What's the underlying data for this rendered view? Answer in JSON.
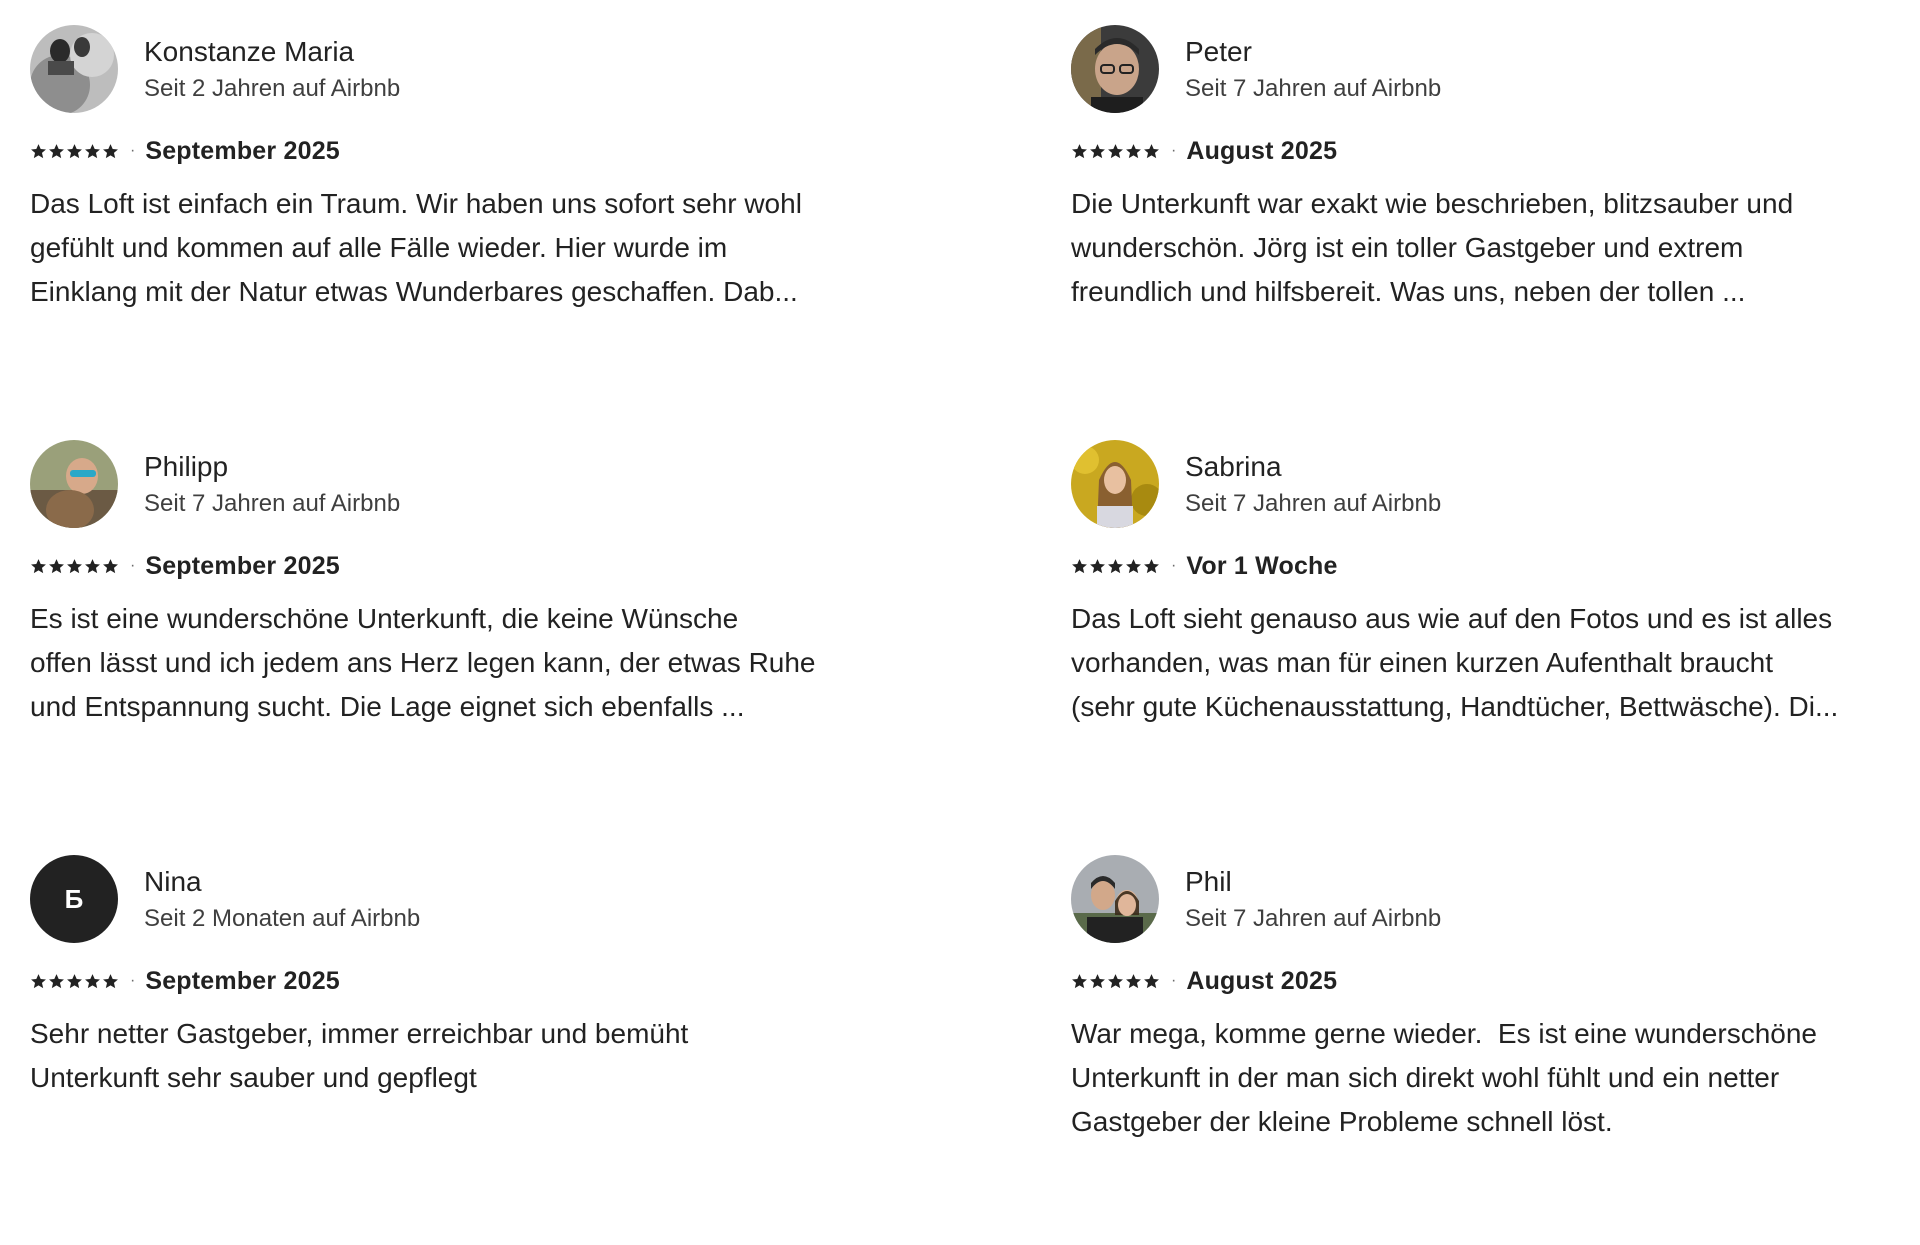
{
  "reviews": [
    {
      "name": "Konstanze Maria",
      "tenure": "Seit 2 Jahren auf Airbnb",
      "rating": 5,
      "date": "September 2025",
      "separator": "·",
      "lines": [
        "Das Loft ist einfach ein Traum. Wir haben uns sofort sehr wohl",
        "gefühlt und kommen auf alle Fälle wieder. Hier wurde im",
        "Einklang mit der Natur etwas Wunderbares geschaffen. Dab..."
      ]
    },
    {
      "name": "Peter",
      "tenure": "Seit 7 Jahren auf Airbnb",
      "rating": 5,
      "date": "August 2025",
      "separator": "·",
      "lines": [
        "Die Unterkunft war exakt wie beschrieben, blitzsauber und",
        "wunderschön. Jörg ist ein toller Gastgeber und extrem",
        "freundlich und hilfsbereit. Was uns, neben der tollen ..."
      ]
    },
    {
      "name": "Philipp",
      "tenure": "Seit 7 Jahren auf Airbnb",
      "rating": 5,
      "date": "September 2025",
      "separator": "·",
      "lines": [
        "Es ist eine wunderschöne Unterkunft, die keine Wünsche",
        "offen lässt und ich jedem ans Herz legen kann, der etwas Ruhe",
        "und Entspannung sucht. Die Lage eignet sich ebenfalls ..."
      ]
    },
    {
      "name": "Sabrina",
      "tenure": "Seit 7 Jahren auf Airbnb",
      "rating": 5,
      "date": "Vor 1 Woche",
      "separator": "·",
      "lines": [
        "Das Loft sieht genauso aus wie auf den Fotos und es ist alles",
        "vorhanden, was man für einen kurzen Aufenthalt braucht",
        "(sehr gute Küchenausstattung, Handtücher, Bettwäsche). Di..."
      ]
    },
    {
      "name": "Nina",
      "initial": "Б",
      "tenure": "Seit 2 Monaten auf Airbnb",
      "rating": 5,
      "date": "September 2025",
      "separator": "·",
      "lines": [
        "Sehr netter Gastgeber, immer erreichbar und bemüht",
        "Unterkunft sehr sauber und gepflegt"
      ]
    },
    {
      "name": "Phil",
      "tenure": "Seit 7 Jahren auf Airbnb",
      "rating": 5,
      "date": "August 2025",
      "separator": "·",
      "lines": [
        "War mega, komme gerne wieder.  Es ist eine wunderschöne",
        "Unterkunft in der man sich direkt wohl fühlt und ein netter",
        "Gastgeber der kleine Probleme schnell löst."
      ]
    }
  ]
}
